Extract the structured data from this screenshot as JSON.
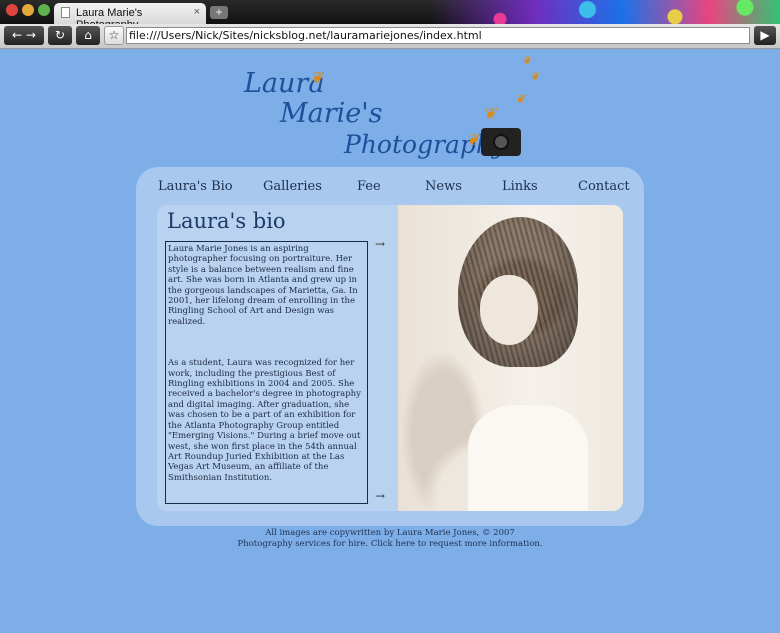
{
  "browser": {
    "tab_title": "Laura Marie's Photography",
    "tab_close": "×",
    "new_tab": "+",
    "url": "file:///Users/Nick/Sites/nicksblog.net/lauramariejones/index.html",
    "back_label": "← →",
    "reload_label": "↻",
    "home_label": "⌂",
    "star_label": "☆",
    "go_label": "▶"
  },
  "logo": {
    "line1": "Laura",
    "line2": "Marie's",
    "line3": "Photography"
  },
  "nav": {
    "items": [
      {
        "label": "Laura's Bio"
      },
      {
        "label": "Galleries"
      },
      {
        "label": "Fee"
      },
      {
        "label": "News"
      },
      {
        "label": "Links"
      },
      {
        "label": "Contact"
      }
    ]
  },
  "bio": {
    "title": "Laura's bio",
    "paragraph1": "Laura Marie Jones is an aspiring photographer focusing  on portraiture. Her style is a balance between realism and fine art. She was born in Atlanta and grew up in the gorgeous landscapes of Marietta, Ga. In 2001, her lifelong dream of enrolling in the Ringling School of Art and Design was realized.",
    "paragraph2": "As a student, Laura was recognized for her work, including the prestigious Best of Ringling exhibitions in 2004 and 2005. She received a bachelor's degree in photography and digital imaging. After graduation, she was chosen to be a part of an exhibition for the Atlanta Photography Group entitled \"Emerging Visions.\" During a brief move out west, she won first place in the 54th annual Art Roundup Juried Exhibition at the Las Vegas Art Museum, an affiliate of the Smithsonian Institution.",
    "scroll_up": "→",
    "scroll_down": "→"
  },
  "footer": {
    "line1": "All images are copywritten by Laura Marie Jones, © 2007",
    "line2": "Photography services for hire. Click here to request more information."
  },
  "colors": {
    "page_background": "#7eaee8",
    "panel_background": "#a8c8f0",
    "logo_text": "#1f4f9a"
  }
}
